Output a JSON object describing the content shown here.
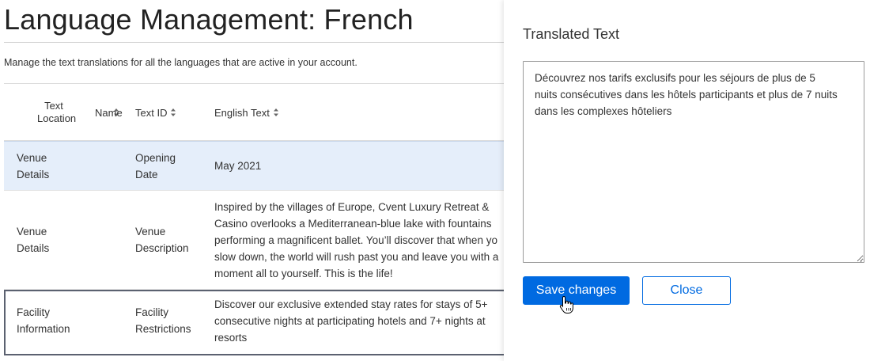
{
  "page": {
    "title": "Language Management: French",
    "description": "Manage the text translations for all the languages that are active in your account."
  },
  "table": {
    "headers": {
      "text_location": [
        "Text",
        "Location"
      ],
      "name": "Name",
      "text_id": "Text ID",
      "english_text": "English Text"
    },
    "rows": [
      {
        "location": [
          "Venue",
          "Details"
        ],
        "text_id": [
          "Opening",
          "Date"
        ],
        "english": [
          "May 2021"
        ]
      },
      {
        "location": [
          "Venue",
          "Details"
        ],
        "text_id": [
          "Venue",
          "Description"
        ],
        "english": [
          "Inspired by the villages of Europe, Cvent Luxury Retreat &",
          "Casino overlooks a Mediterranean-blue lake with fountains",
          "performing a magnificent ballet. You’ll discover that when yo",
          "slow down, the world will rush past you and leave you with a",
          "moment all to yourself. This is the life!"
        ]
      },
      {
        "location": [
          "Facility",
          "Information"
        ],
        "text_id": [
          "Facility",
          "Restrictions"
        ],
        "english": [
          "Discover our exclusive extended stay rates for stays of 5+",
          "consecutive nights at participating hotels and 7+ nights at",
          "resorts"
        ]
      }
    ]
  },
  "panel": {
    "title": "Translated Text",
    "translated_lines": [
      "Découvrez nos tarifs exclusifs pour les séjours de plus de 5",
      "nuits consécutives dans les hôtels participants et plus de 7 nuits",
      "dans les complexes hôteliers"
    ],
    "save_label": "Save changes",
    "close_label": "Close"
  },
  "colors": {
    "primary": "#006ae1",
    "selected_row": "#e5eefa",
    "focus_border": "#5b6170"
  },
  "icons": [
    "sort-icon",
    "hand-pointer-icon",
    "resize-grip-icon"
  ]
}
